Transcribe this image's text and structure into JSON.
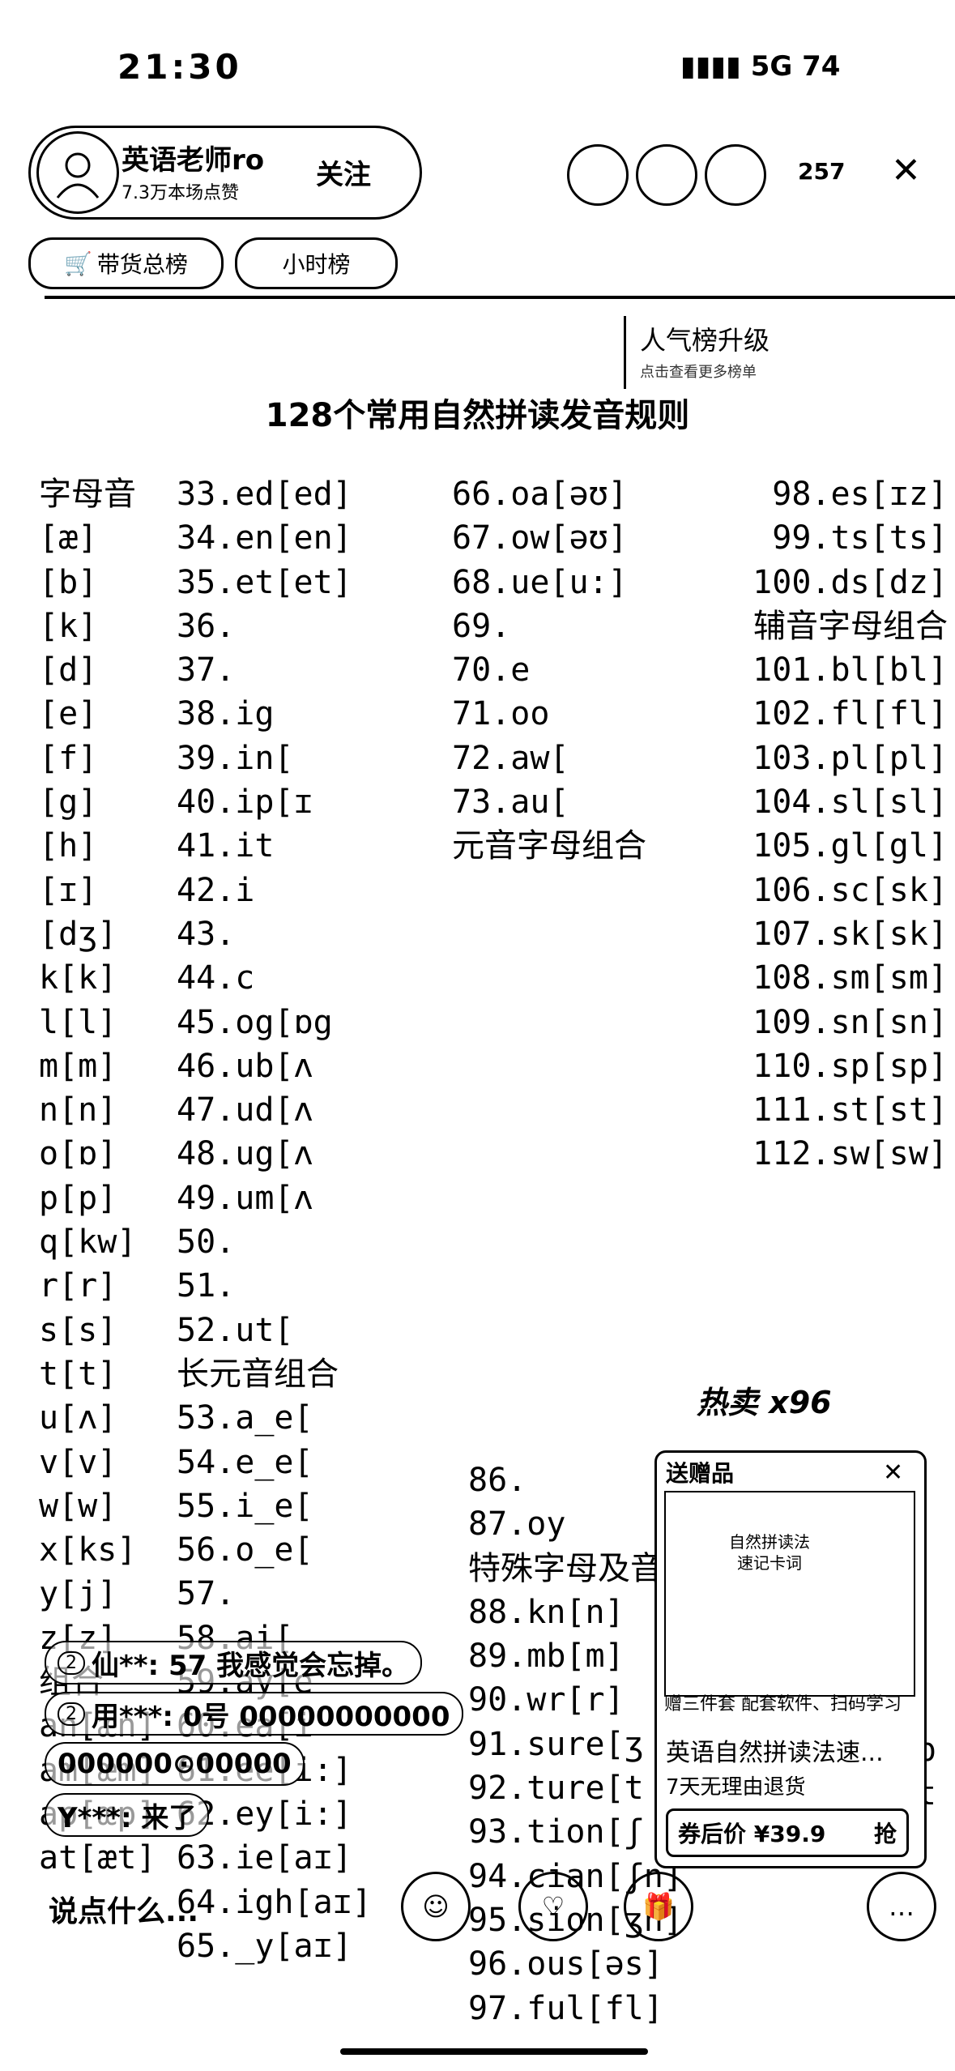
{
  "status_bar": {
    "time": "21:30",
    "network": "5G",
    "battery": "74"
  },
  "host": {
    "name": "英语老师ro",
    "sub": "7.3万本场点赞",
    "follow": "关注"
  },
  "viewer_count": "257",
  "tags": {
    "sales_rank": "带货总榜",
    "small_hour_rank": "小时榜"
  },
  "rank_badge": {
    "text": "人气榜升级",
    "sub": "点击查看更多榜单"
  },
  "sheet": {
    "title": "128个常用自然拼读发音规则",
    "col1": [
      "字母音",
      "[æ]",
      "[b]",
      "[k]",
      "[d]",
      "[e]",
      "[f]",
      "[g]",
      "[h]",
      "[ɪ]",
      "[dʒ]",
      "k[k]",
      "l[l]",
      "m[m]",
      "n[n]",
      "o[ɒ]",
      "p[p]",
      "q[kw]",
      "r[r]",
      "s[s]",
      "t[t]",
      "u[ʌ]",
      "v[v]",
      "w[w]",
      "x[ks]",
      "y[j]",
      "z[z]",
      "组合",
      "an[æn]",
      "am[æm]",
      "ap[æp]",
      "at[æt]"
    ],
    "col2": [
      "33.ed[ed]",
      "34.en[en]",
      "35.et[et]",
      "36.",
      "37.",
      "38.ig",
      "39.in[",
      "40.ip[ɪ",
      "41.it",
      "42.i",
      "43.",
      "44.c",
      "45.og[ɒg",
      "46.ub[ʌ",
      "47.ud[ʌ",
      "48.ug[ʌ",
      "49.um[ʌ",
      "50.",
      "51.",
      "52.ut[",
      "长元音组合",
      "53.a_e[",
      "54.e_e[",
      "55.i_e[",
      "56.o_e[",
      "57.",
      "58.ai[",
      "59.ay[e",
      "60.ea[i",
      "61.ee[i:]",
      "62.ey[i:]",
      "63.ie[aɪ]",
      "64.igh[aɪ]",
      "65._y[aɪ]"
    ],
    "col3": [
      "66.oa[əʊ]",
      "67.ow[əʊ]",
      "68.ue[u:]",
      "69.",
      "70.e",
      "71.oo",
      "72.aw[",
      "73.au[",
      "元音字母组合"
    ],
    "col3b": [
      "86.",
      "87.oy",
      "特殊字母及音",
      "88.kn[n]",
      "89.mb[m]",
      "90.wr[r]",
      "91.sure[ʒ",
      "92.ture[t",
      "93.tion[ʃ",
      "94.cian[ʃn]",
      "95.sion[ʒn]",
      "96.ous[əs]",
      "97.ful[fl]"
    ],
    "col4": [
      "98.es[ɪz]",
      "99.ts[ts]",
      "100.ds[dz]",
      "辅音字母组合",
      "101.bl[bl]",
      "102.fl[fl]",
      "103.pl[pl]",
      "104.sl[sl]",
      "105.gl[gl]",
      "106.sc[sk]",
      "107.sk[sk]",
      "108.sm[sm]",
      "109.sn[sn]",
      "110.sp[sp]",
      "111.st[st]",
      "112.sw[sw]"
    ],
    "col4b": [
      "127.spr[sp",
      "128.str[st"
    ]
  },
  "chat": [
    {
      "level": "2",
      "text": "仙**: 57 我感觉会忘掉。"
    },
    {
      "level": "2",
      "text": "用***: 0号 00000000000"
    },
    {
      "level": "",
      "text": "000000⊙00000"
    },
    {
      "level": "",
      "text": "Y***: 来了"
    }
  ],
  "hot": "热卖 x96",
  "promo": {
    "badge": "送赠品",
    "image_title": "自然拼读法\n速记卡词",
    "strip": "赠三件套  配套软件、扫码学习",
    "title": "英语自然拼读法速...",
    "subtitle": "7天无理由退货",
    "price": "券后价 ¥39.9",
    "buy": "抢"
  },
  "bottom": {
    "comment_placeholder": "说点什么...",
    "more": "…"
  }
}
